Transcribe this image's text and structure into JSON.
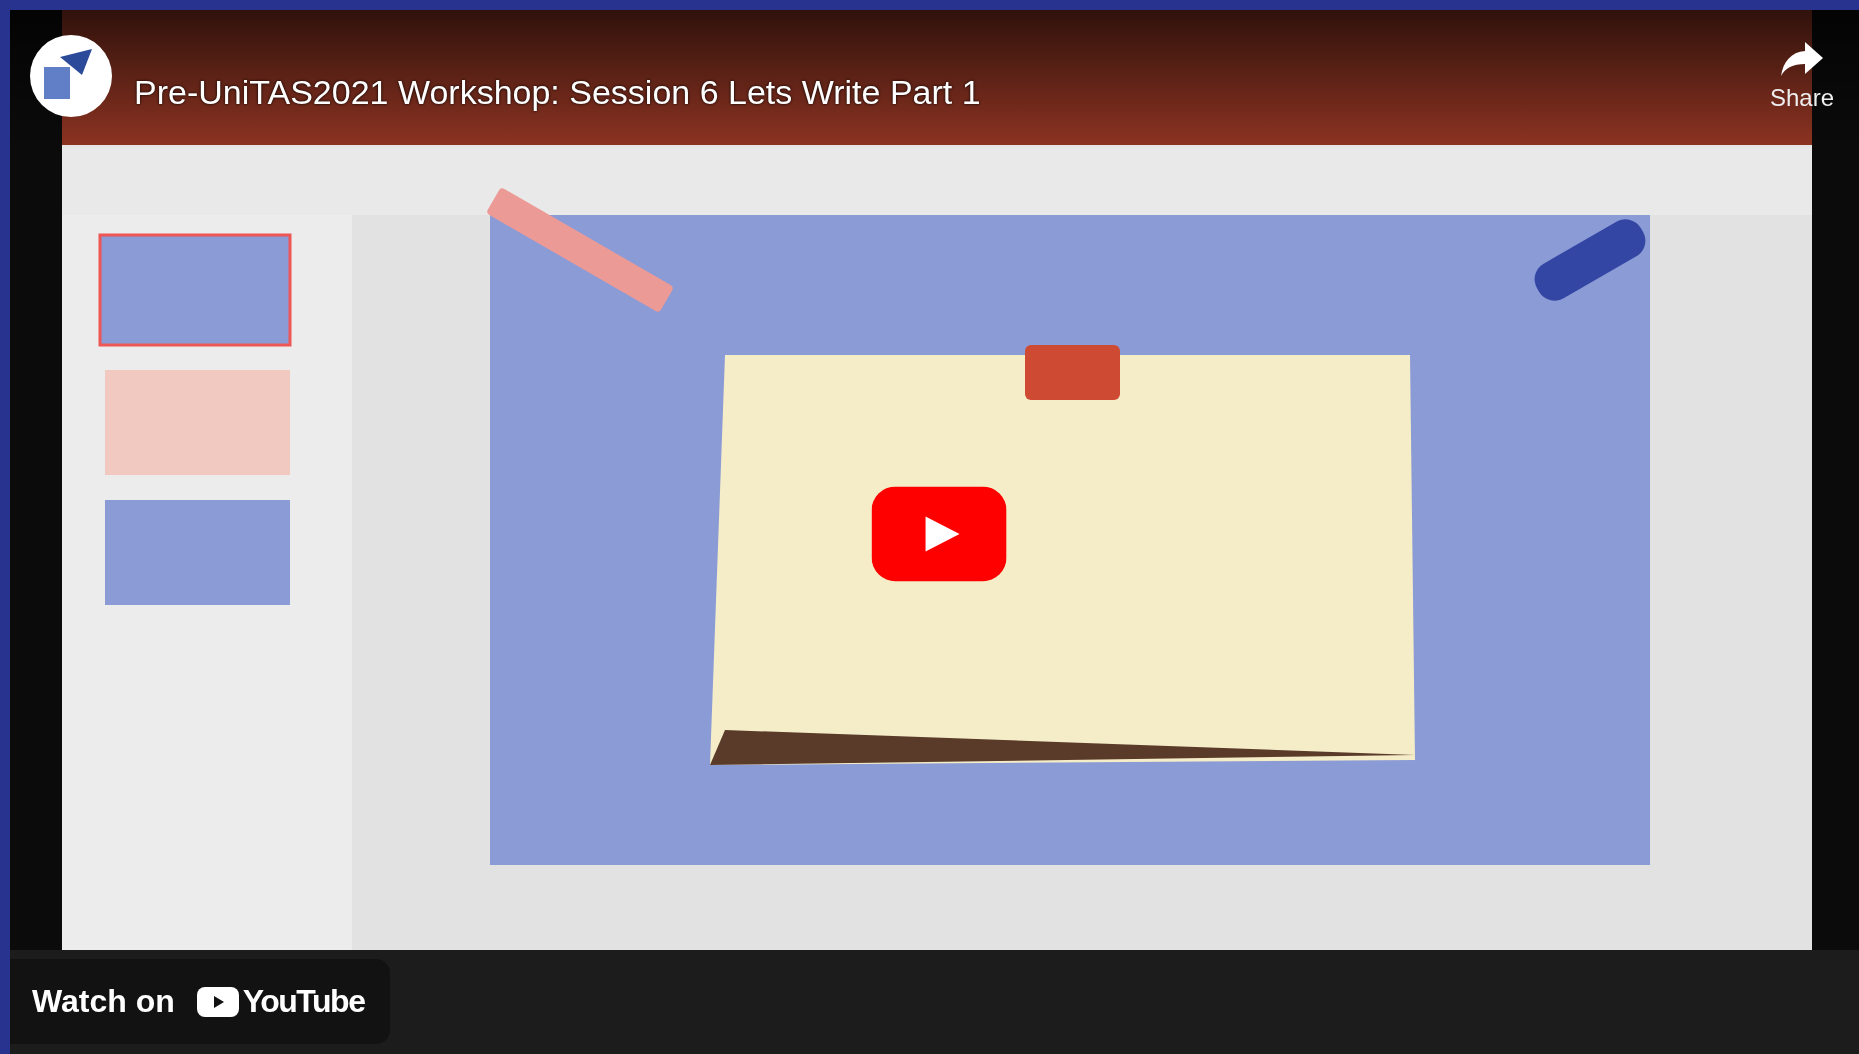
{
  "video": {
    "title": "Pre-UniTAS2021 Workshop: Session 6 Lets Write Part 1",
    "share_label": "Share",
    "watch_on": "Watch on",
    "platform": "YouTube"
  }
}
